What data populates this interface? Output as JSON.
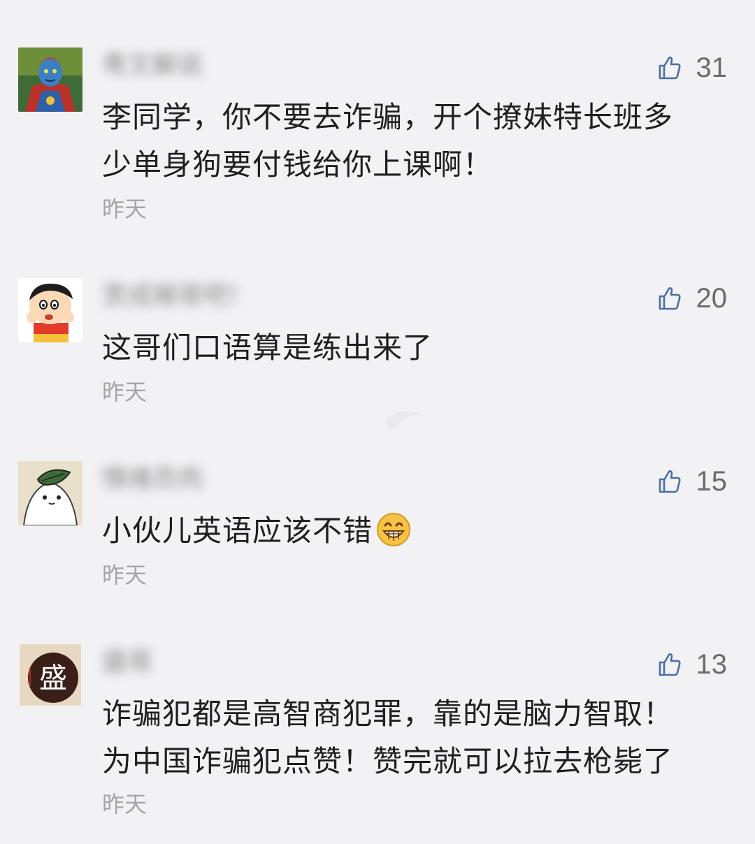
{
  "comments": [
    {
      "nickname": "粤文解说",
      "likes": "31",
      "text_lines": [
        "李同学，你不要去诈骗，开个撩妹特长班多",
        "少单身狗要付钱给你上课啊！"
      ],
      "time": "昨天",
      "avatar": "superhero-avatar"
    },
    {
      "nickname": "赏成猴哥吧！",
      "likes": "20",
      "text_lines": [
        "这哥们口语算是练出来了"
      ],
      "time": "昨天",
      "avatar": "cartoon-boy-avatar"
    },
    {
      "nickname": "情绪员肉",
      "likes": "15",
      "text_lines": [
        "小伙儿英语应该不错"
      ],
      "emoji": "grinning-emoji",
      "time": "昨天",
      "avatar": "seal-leaf-avatar"
    },
    {
      "nickname": "盛哥",
      "likes": "13",
      "text_lines": [
        "诈骗犯都是高智商犯罪，靠的是脑力智取！",
        "为中国诈骗犯点赞！赞完就可以拉去枪毙了"
      ],
      "time": "昨天",
      "avatar": "calligraphy-logo-avatar",
      "avatar_char": "盛"
    }
  ],
  "colors": {
    "background": "#f2f2f4",
    "like_icon": "#4a6fa5",
    "time_text": "#a6a6a6"
  }
}
